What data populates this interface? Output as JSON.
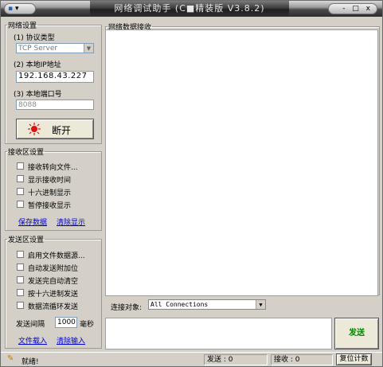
{
  "window": {
    "title": "网络调试助手 (C■精装版 V3.8.2)",
    "sysmenu_label": "▾",
    "controls_label": "- □ x"
  },
  "net_settings": {
    "legend": "网络设置",
    "protocol_label": "(1) 协议类型",
    "protocol_value": "TCP Server",
    "ip_label": "(2) 本地IP地址",
    "ip_value": "192.168.43.227",
    "port_label": "(3) 本地端口号",
    "port_value": "8088",
    "connect_button": "断开"
  },
  "recv_settings": {
    "legend": "接收区设置",
    "options": [
      "接收转向文件...",
      "显示接收时间",
      "十六进制显示",
      "暂停接收显示"
    ],
    "save_link": "保存数据",
    "clear_link": "清除显示"
  },
  "send_settings": {
    "legend": "发送区设置",
    "options": [
      "启用文件数据源...",
      "自动发送附加位",
      "发送完自动清空",
      "按十六进制发送",
      "数据流循环发送"
    ],
    "interval_label": "发送间隔",
    "interval_value": "1000",
    "interval_unit": "毫秒",
    "load_file_link": "文件载入",
    "clear_input_link": "清除输入"
  },
  "recv_area": {
    "title": "网络数据接收"
  },
  "send_bar": {
    "target_label": "连接对象:",
    "target_value": "All Connections",
    "send_button": "发送"
  },
  "statusbar": {
    "status": "就绪!",
    "sent_label": "发送 : 0",
    "recv_label": "接收 : 0",
    "reset_button": "复位计数"
  },
  "colors": {
    "connect_indicator": "#e01010",
    "link": "#0000cc",
    "send_text": "#008000"
  }
}
